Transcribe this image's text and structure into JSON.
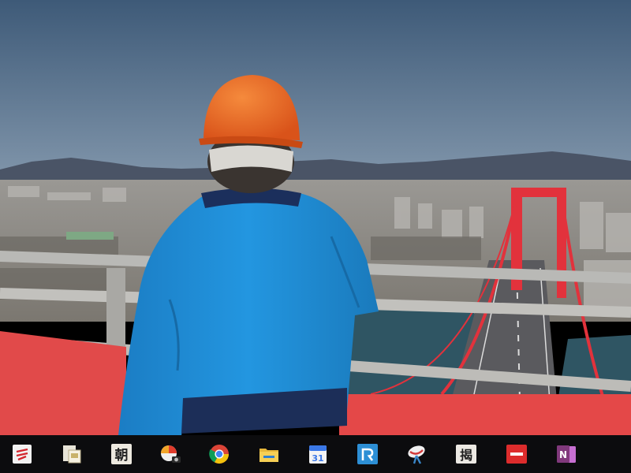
{
  "wallpaper": {
    "colors": {
      "sky_top": "#3e5a78",
      "sky_bottom": "#8a9eb2",
      "mountains": "#4a5466",
      "city": "#8c8a88",
      "water": "#2f5563",
      "helmet": "#e8621c",
      "jacket": "#1f8fd6",
      "bridge": "#e2323c",
      "railing": "#b9b9b6"
    }
  },
  "taskbar": {
    "background": "#0c0c0e",
    "apps": [
      {
        "name": "app-red-doc",
        "icon": "red-document-icon"
      },
      {
        "name": "app-photo-viewer",
        "icon": "photo-viewer-icon"
      },
      {
        "name": "app-asahi",
        "icon": "newspaper-icon",
        "glyph": "朝"
      },
      {
        "name": "app-camera",
        "icon": "camera-icon"
      },
      {
        "name": "app-chrome",
        "icon": "chrome-icon"
      },
      {
        "name": "app-file-explorer",
        "icon": "folder-icon"
      },
      {
        "name": "app-calendar",
        "icon": "calendar-icon",
        "text": "31"
      },
      {
        "name": "app-blue-r",
        "icon": "blue-r-icon"
      },
      {
        "name": "app-satellite",
        "icon": "satellite-dish-icon"
      },
      {
        "name": "app-dictionary",
        "icon": "dictionary-icon",
        "glyph": "揭"
      },
      {
        "name": "app-red-minus",
        "icon": "red-minus-icon"
      },
      {
        "name": "app-onenote",
        "icon": "onenote-icon",
        "text": "N"
      }
    ]
  }
}
